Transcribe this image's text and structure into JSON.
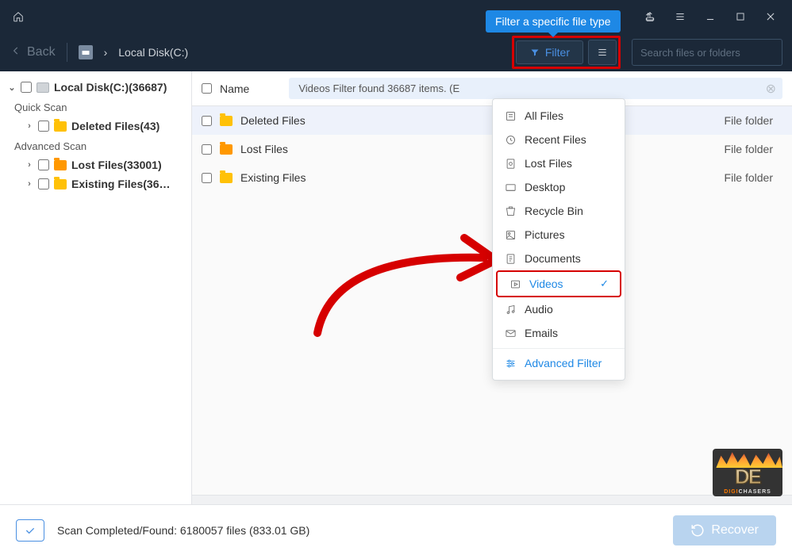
{
  "tooltip": "Filter a specific file type",
  "titlebar": {},
  "toolbar": {
    "back_label": "Back",
    "breadcrumb_sep": "›",
    "breadcrumb": "Local Disk(C:)",
    "filter_label": "Filter",
    "search_placeholder": "Search files or folders"
  },
  "sidebar": {
    "root": "Local Disk(C:)(36687)",
    "quick_label": "Quick Scan",
    "quick_items": [
      "Deleted Files(43)"
    ],
    "advanced_label": "Advanced Scan",
    "advanced_items": [
      "Lost Files(33001)",
      "Existing Files(36…"
    ]
  },
  "main": {
    "name_header": "Name",
    "banner": "Videos Filter found 36687 items. (E",
    "rows": [
      {
        "name": "Deleted Files",
        "type": "File folder",
        "selected": true
      },
      {
        "name": "Lost Files",
        "type": "File folder",
        "selected": false
      },
      {
        "name": "Existing Files",
        "type": "File folder",
        "selected": false
      }
    ]
  },
  "dropdown": {
    "items": [
      "All Files",
      "Recent Files",
      "Lost Files",
      "Desktop",
      "Recycle Bin",
      "Pictures",
      "Documents",
      "Videos",
      "Audio",
      "Emails"
    ],
    "active_index": 7,
    "advanced": "Advanced Filter"
  },
  "footer": {
    "status": "Scan Completed/Found: 6180057 files (833.01 GB)",
    "recover": "Recover"
  },
  "watermark": {
    "logo": "DE",
    "sub_a": "DIGI",
    "sub_b": "CHASERS"
  }
}
